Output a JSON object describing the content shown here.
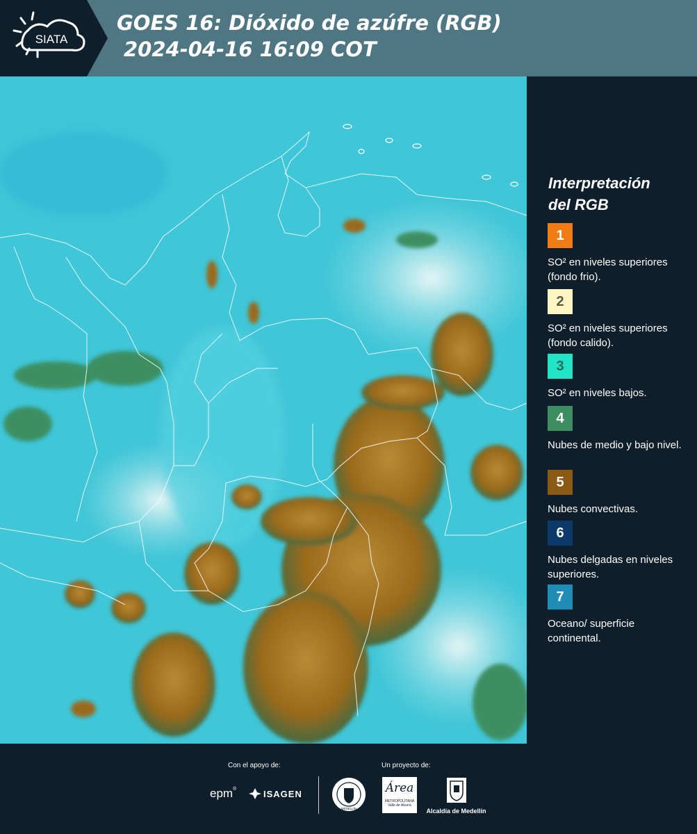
{
  "header": {
    "logo_text": "SIATA",
    "title_line1": "GOES 16: Dióxido de azúfre (RGB)",
    "title_line2": "2024-04-16 16:09 COT"
  },
  "legend": {
    "title_line1": "Interpretación",
    "title_line2": "del RGB",
    "items": [
      {
        "number": "1",
        "color": "#f07d13",
        "text_color": "#ffffff",
        "text": "SO² en niveles superiores (fondo frio)."
      },
      {
        "number": "2",
        "color": "#fdf5c2",
        "text_color": "#5a5a40",
        "text": "SO² en niveles superiores (fondo calido)."
      },
      {
        "number": "3",
        "color": "#22e3c4",
        "text_color": "#2a6a60",
        "text": "SO² en niveles bajos."
      },
      {
        "number": "4",
        "color": "#3d8f62",
        "text_color": "#ffffff",
        "text": "Nubes de medio y bajo nivel."
      },
      {
        "number": "5",
        "color": "#8a5a14",
        "text_color": "#ffffff",
        "text": "Nubes convectivas."
      },
      {
        "number": "6",
        "color": "#0c3a6b",
        "text_color": "#ffffff",
        "text": "Nubes delgadas en niveles superiores."
      },
      {
        "number": "7",
        "color": "#1f8db8",
        "text_color": "#ffffff",
        "text": "Oceano/ superficie continental."
      }
    ]
  },
  "footer": {
    "support_label": "Con el apoyo de:",
    "project_label": "Un proyecto de:",
    "sponsors": [
      "epm",
      "ISAGEN"
    ],
    "partners": {
      "area_name": "Área",
      "area_sub1": "METROPOLITANA",
      "area_sub2": "Valle de Aburrá",
      "alcaldia": "Alcaldía de Medellín",
      "seal_text": "MEDELLÍN"
    }
  },
  "colors": {
    "header_bg": "#4f7683",
    "panel_bg": "#0e1f2b",
    "sky_cyan": "#3fc6d8",
    "cloud_brown": "#8a5a14"
  }
}
